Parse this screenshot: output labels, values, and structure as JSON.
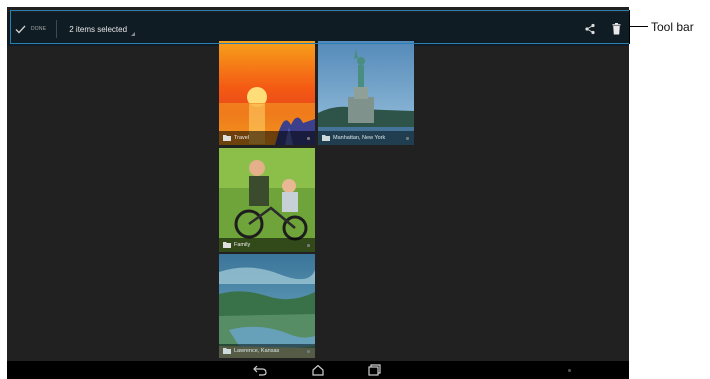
{
  "toolbar": {
    "done_label": "DONE",
    "selection_label": "2 items selected",
    "actions": [
      "share-icon",
      "delete-icon"
    ]
  },
  "albums": [
    {
      "label": "Travel",
      "selected": false
    },
    {
      "label": "Manhattan, New York",
      "selected": true
    },
    {
      "label": "Family",
      "selected": false
    },
    {
      "label": "Lawrence, Kansas",
      "selected": true
    }
  ],
  "navbar": {
    "buttons": [
      "back-icon",
      "home-icon",
      "recent-apps-icon",
      "menu-icon"
    ]
  },
  "callout": {
    "label": "Tool bar"
  },
  "colors": {
    "toolbar_bg": "#101c24",
    "screen_bg": "#212121",
    "selection_accent": "#2bb5c9",
    "callout_frame": "#2a7fb0"
  }
}
